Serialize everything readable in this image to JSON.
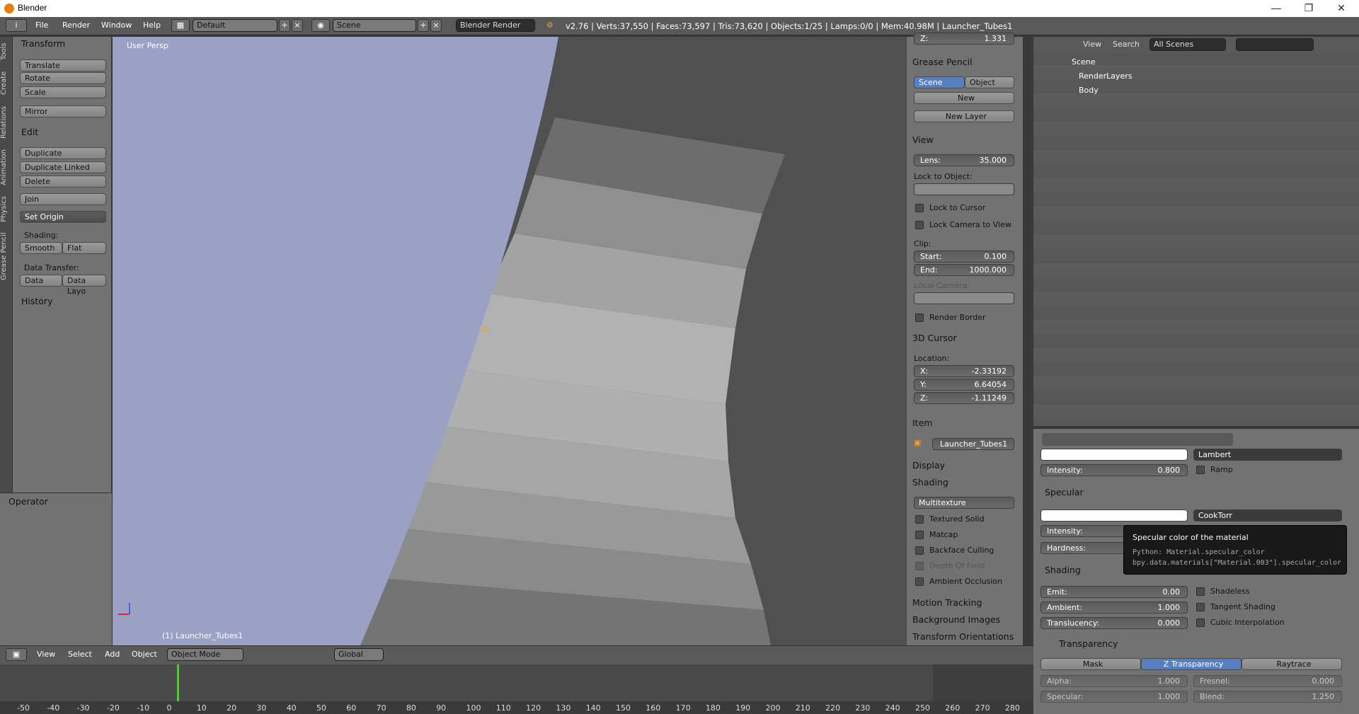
{
  "window": {
    "title": "Blender"
  },
  "menu": [
    "File",
    "Render",
    "Window",
    "Help"
  ],
  "header": {
    "layout": "Default",
    "scene": "Scene",
    "engine": "Blender Render",
    "stats": "v2.76 | Verts:37,550 | Faces:73,597 | Tris:73,620 | Objects:1/25 | Lamps:0/0 | Mem:40.98M | Launcher_Tubes1"
  },
  "tool_tabs": [
    "Tools",
    "Create",
    "Relations",
    "Animation",
    "Physics",
    "Grease Pencil"
  ],
  "tools": {
    "transform_title": "Transform",
    "translate": "Translate",
    "rotate": "Rotate",
    "scale": "Scale",
    "mirror": "Mirror",
    "edit_title": "Edit",
    "duplicate": "Duplicate",
    "duplicate_linked": "Duplicate Linked",
    "delete": "Delete",
    "join": "Join",
    "set_origin": "Set Origin",
    "shading_label": "Shading:",
    "smooth": "Smooth",
    "flat": "Flat",
    "data_transfer_label": "Data Transfer:",
    "data": "Data",
    "data_layo": "Data Layo",
    "history": "History",
    "operator": "Operator"
  },
  "viewport": {
    "label": "User Persp",
    "object_label": "(1) Launcher_Tubes1"
  },
  "npanel": {
    "z_top": "Z:",
    "z_top_val": "1.331",
    "grease_pencil": "Grease Pencil",
    "gp_scene": "Scene",
    "gp_object": "Object",
    "gp_new": "New",
    "new_layer": "New Layer",
    "view": "View",
    "lens": "Lens:",
    "lens_val": "35.000",
    "lock_to_object": "Lock to Object:",
    "lock_cursor": "Lock to Cursor",
    "lock_camera": "Lock Camera to View",
    "clip": "Clip:",
    "clip_start": "Start:",
    "clip_start_val": "0.100",
    "clip_end": "End:",
    "clip_end_val": "1000.000",
    "local_camera": "Local Camera:",
    "render_border": "Render Border",
    "cursor3d": "3D Cursor",
    "location": "Location:",
    "cx": "X:",
    "cx_val": "-2.33192",
    "cy": "Y:",
    "cy_val": "6.64054",
    "cz": "Z:",
    "cz_val": "-1.11249",
    "item": "Item",
    "item_name": "Launcher_Tubes1",
    "display": "Display",
    "shading": "Shading",
    "shading_mode": "Multitexture",
    "textured_solid": "Textured Solid",
    "matcap": "Matcap",
    "backface": "Backface Culling",
    "dof": "Depth Of Field",
    "ao": "Ambient Occlusion",
    "motion_tracking": "Motion Tracking",
    "bg_images": "Background Images",
    "transform_orient": "Transform Orientations"
  },
  "outliner": {
    "view": "View",
    "search": "Search",
    "scenes": "All Scenes",
    "scene": "Scene",
    "renderlayers": "RenderLayers",
    "body": "Body"
  },
  "props": {
    "diffuse_shader": "Lambert",
    "intensity": "Intensity:",
    "intensity_val": "0.800",
    "ramp": "Ramp",
    "specular": "Specular",
    "spec_shader": "CookTorr",
    "spec_intensity": "Intensity:",
    "hardness": "Hardness:",
    "shading": "Shading",
    "emit": "Emit:",
    "emit_val": "0.00",
    "shadeless": "Shadeless",
    "ambient": "Ambient:",
    "ambient_val": "1.000",
    "tangent": "Tangent Shading",
    "translucency": "Translucency:",
    "translucency_val": "0.000",
    "cubic": "Cubic Interpolation",
    "transparency": "Transparency",
    "mask": "Mask",
    "ztrans": "Z Transparency",
    "raytrace": "Raytrace",
    "alpha": "Alpha:",
    "alpha_val": "1.000",
    "fresnel": "Fresnel:",
    "fresnel_val": "0.000",
    "spec2": "Specular:",
    "spec2_val": "1.000",
    "blend": "Blend:",
    "blend_val": "1.250"
  },
  "tooltip": {
    "title": "Specular color of the material",
    "python": "Python: Material.specular_color",
    "path": "bpy.data.materials[\"Material.003\"].specular_color"
  },
  "view_header": {
    "view": "View",
    "select": "Select",
    "add": "Add",
    "object": "Object",
    "mode": "Object Mode",
    "orient": "Global"
  },
  "timeline": {
    "ticks": [
      "-50",
      "-40",
      "-30",
      "-20",
      "-10",
      "0",
      "10",
      "20",
      "30",
      "40",
      "50",
      "60",
      "70",
      "80",
      "90",
      "100",
      "110",
      "120",
      "130",
      "140",
      "150",
      "160",
      "170",
      "180",
      "190",
      "200",
      "210",
      "220",
      "230",
      "240",
      "250",
      "260",
      "270",
      "280"
    ]
  }
}
